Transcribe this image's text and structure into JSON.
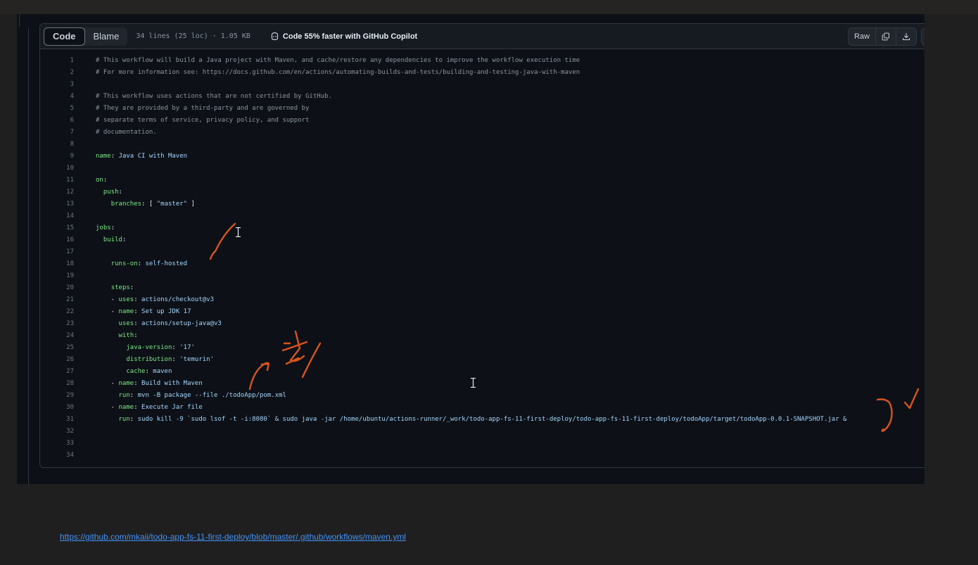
{
  "tabs": {
    "code": "Code",
    "blame": "Blame"
  },
  "file_meta": "34 lines (25 loc) · 1.05 KB",
  "copilot_text": "Code 55% faster with GitHub Copilot",
  "actions": {
    "raw": "Raw"
  },
  "lines": [
    {
      "n": "1",
      "segs": [
        [
          "c",
          "# This workflow will build a Java project with Maven, and cache/restore any dependencies to improve the workflow execution time"
        ]
      ]
    },
    {
      "n": "2",
      "segs": [
        [
          "c",
          "# For more information see: https://docs.github.com/en/actions/automating-builds-and-tests/building-and-testing-java-with-maven"
        ]
      ]
    },
    {
      "n": "3",
      "segs": []
    },
    {
      "n": "4",
      "segs": [
        [
          "c",
          "# This workflow uses actions that are not certified by GitHub."
        ]
      ]
    },
    {
      "n": "5",
      "segs": [
        [
          "c",
          "# They are provided by a third-party and are governed by"
        ]
      ]
    },
    {
      "n": "6",
      "segs": [
        [
          "c",
          "# separate terms of service, privacy policy, and support"
        ]
      ]
    },
    {
      "n": "7",
      "segs": [
        [
          "c",
          "# documentation."
        ]
      ]
    },
    {
      "n": "8",
      "segs": []
    },
    {
      "n": "9",
      "segs": [
        [
          "k",
          "name"
        ],
        [
          "p",
          ": "
        ],
        [
          "s",
          "Java CI with Maven"
        ]
      ]
    },
    {
      "n": "10",
      "segs": []
    },
    {
      "n": "11",
      "segs": [
        [
          "k",
          "on"
        ],
        [
          "p",
          ":"
        ]
      ]
    },
    {
      "n": "12",
      "segs": [
        [
          "p",
          "  "
        ],
        [
          "k",
          "push"
        ],
        [
          "p",
          ":"
        ]
      ]
    },
    {
      "n": "13",
      "segs": [
        [
          "p",
          "    "
        ],
        [
          "k",
          "branches"
        ],
        [
          "p",
          ": [ "
        ],
        [
          "s",
          "\"master\""
        ],
        [
          "p",
          " ]"
        ]
      ]
    },
    {
      "n": "14",
      "segs": []
    },
    {
      "n": "15",
      "segs": [
        [
          "k",
          "jobs"
        ],
        [
          "p",
          ":"
        ]
      ]
    },
    {
      "n": "16",
      "segs": [
        [
          "p",
          "  "
        ],
        [
          "k",
          "build"
        ],
        [
          "p",
          ":"
        ]
      ]
    },
    {
      "n": "17",
      "segs": []
    },
    {
      "n": "18",
      "segs": [
        [
          "p",
          "    "
        ],
        [
          "k",
          "runs-on"
        ],
        [
          "p",
          ": "
        ],
        [
          "s",
          "self-hosted"
        ]
      ]
    },
    {
      "n": "19",
      "segs": []
    },
    {
      "n": "20",
      "segs": [
        [
          "p",
          "    "
        ],
        [
          "k",
          "steps"
        ],
        [
          "p",
          ":"
        ]
      ]
    },
    {
      "n": "21",
      "segs": [
        [
          "p",
          "    - "
        ],
        [
          "k",
          "uses"
        ],
        [
          "p",
          ": "
        ],
        [
          "s",
          "actions/checkout@v3"
        ]
      ]
    },
    {
      "n": "22",
      "segs": [
        [
          "p",
          "    - "
        ],
        [
          "k",
          "name"
        ],
        [
          "p",
          ": "
        ],
        [
          "s",
          "Set up JDK 17"
        ]
      ]
    },
    {
      "n": "23",
      "segs": [
        [
          "p",
          "      "
        ],
        [
          "k",
          "uses"
        ],
        [
          "p",
          ": "
        ],
        [
          "s",
          "actions/setup-java@v3"
        ]
      ]
    },
    {
      "n": "24",
      "segs": [
        [
          "p",
          "      "
        ],
        [
          "k",
          "with"
        ],
        [
          "p",
          ":"
        ]
      ]
    },
    {
      "n": "25",
      "segs": [
        [
          "p",
          "        "
        ],
        [
          "k",
          "java-version"
        ],
        [
          "p",
          ": "
        ],
        [
          "s",
          "'17'"
        ]
      ]
    },
    {
      "n": "26",
      "segs": [
        [
          "p",
          "        "
        ],
        [
          "k",
          "distribution"
        ],
        [
          "p",
          ": "
        ],
        [
          "s",
          "'temurin'"
        ]
      ]
    },
    {
      "n": "27",
      "segs": [
        [
          "p",
          "        "
        ],
        [
          "k",
          "cache"
        ],
        [
          "p",
          ": "
        ],
        [
          "s",
          "maven"
        ]
      ]
    },
    {
      "n": "28",
      "segs": [
        [
          "p",
          "    - "
        ],
        [
          "k",
          "name"
        ],
        [
          "p",
          ": "
        ],
        [
          "s",
          "Build with Maven"
        ]
      ]
    },
    {
      "n": "29",
      "segs": [
        [
          "p",
          "      "
        ],
        [
          "k",
          "run"
        ],
        [
          "p",
          ": "
        ],
        [
          "s",
          "mvn -B package --file ./todoApp/pom.xml"
        ]
      ]
    },
    {
      "n": "30",
      "segs": [
        [
          "p",
          "    - "
        ],
        [
          "k",
          "name"
        ],
        [
          "p",
          ": "
        ],
        [
          "s",
          "Execute Jar file"
        ]
      ]
    },
    {
      "n": "31",
      "segs": [
        [
          "p",
          "      "
        ],
        [
          "k",
          "run"
        ],
        [
          "p",
          ": "
        ],
        [
          "s",
          "sudo kill -9 `sudo lsof -t -i:8080` & sudo java -jar /home/ubuntu/actions-runner/_work/todo-app-fs-11-first-deploy/todo-app-fs-11-first-deploy/todoApp/target/todoApp-0.0.1-SNAPSHOT.jar &"
        ]
      ]
    },
    {
      "n": "32",
      "segs": []
    },
    {
      "n": "33",
      "segs": []
    },
    {
      "n": "34",
      "segs": []
    }
  ],
  "link": "https://github.com/mkaii/todo-app-fs-11-first-deploy/blob/master/.github/workflows/maven.yml",
  "colors": {
    "accent_link": "#4493f8",
    "annotation": "#d9541e",
    "comment": "#8b949e",
    "key": "#7ee787",
    "string": "#a5d6ff"
  }
}
